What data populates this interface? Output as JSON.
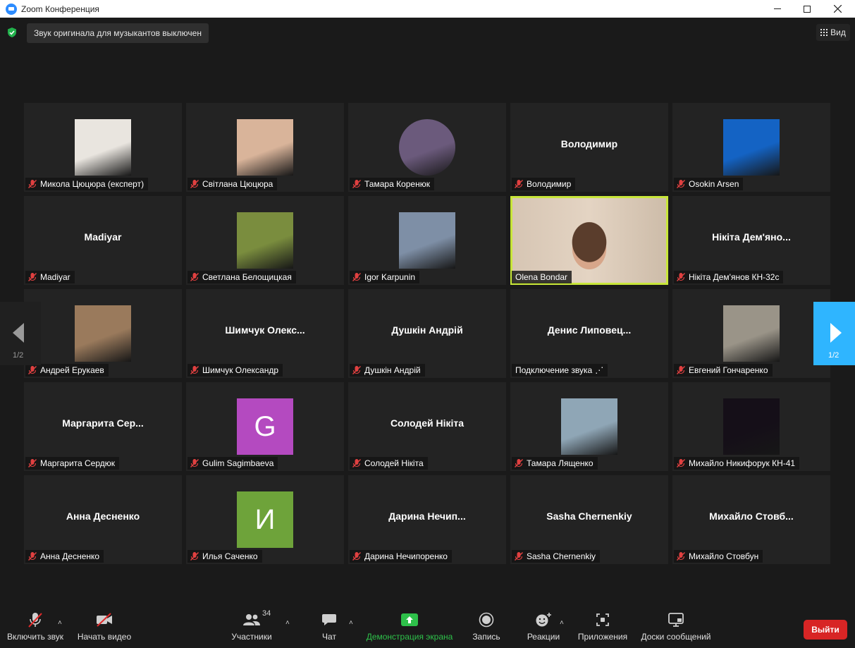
{
  "window": {
    "title": "Zoom Конференция"
  },
  "top": {
    "original_sound": "Звук оригинала для музыкантов выключен",
    "view_label": "Вид"
  },
  "nav": {
    "prev_page": "1/2",
    "next_page": "1/2"
  },
  "tiles": [
    {
      "label": "Микола Цюцюра (експерт)",
      "type": "photo",
      "color": "#e9e5df"
    },
    {
      "label": "Світлана Цюцюра",
      "type": "photo",
      "color": "#d9b49a"
    },
    {
      "label": "Тамара Коренюк",
      "type": "photo-circle",
      "color": "#6b5a7c"
    },
    {
      "label": "Володимир",
      "type": "name",
      "display": "Володимир"
    },
    {
      "label": "Osokin Arsen",
      "type": "photo",
      "color": "#1463c4"
    },
    {
      "label": "Madiyar",
      "type": "name",
      "display": "Madiyar"
    },
    {
      "label": "Светлана Белощицкая",
      "type": "photo",
      "color": "#7a8d3e"
    },
    {
      "label": "Igor Karpunin",
      "type": "photo",
      "color": "#7e8fa6"
    },
    {
      "label": "Olena Bondar",
      "type": "video",
      "active": true,
      "muted": false
    },
    {
      "label": "Нікіта Дем'янов КН-32с",
      "type": "name",
      "display": "Нікіта Дем'яно..."
    },
    {
      "label": "Андрей Ерукаев",
      "type": "photo",
      "color": "#9a7a5c"
    },
    {
      "label": "Шимчук Олександр",
      "type": "name",
      "display": "Шимчук Олекс..."
    },
    {
      "label": "Душкін Андрій",
      "type": "name",
      "display": "Душкін Андрій"
    },
    {
      "label": "Подключение звука",
      "type": "name",
      "display": "Денис Липовец...",
      "muted": false
    },
    {
      "label": "Евгений Гончаренко",
      "type": "photo",
      "color": "#9a9488"
    },
    {
      "label": "Маргарита Сердюк",
      "type": "name",
      "display": "Маргарита Сер..."
    },
    {
      "label": "Gulim Sagimbaeva",
      "type": "letter",
      "letter": "G",
      "color": "#b44ac0"
    },
    {
      "label": "Солодей Нікіта",
      "type": "name",
      "display": "Солодей Нікіта"
    },
    {
      "label": "Тамара Лященко",
      "type": "photo",
      "color": "#8fa6b6"
    },
    {
      "label": "Михайло Никифорук КН-41",
      "type": "photo",
      "color": "#150f18"
    },
    {
      "label": "Анна Десненко",
      "type": "name",
      "display": "Анна Десненко"
    },
    {
      "label": "Илья Саченко",
      "type": "letter",
      "letter": "И",
      "color": "#6ea33a"
    },
    {
      "label": "Дарина Нечипоренко",
      "type": "name",
      "display": "Дарина Нечип..."
    },
    {
      "label": "Sasha Chernenkiy",
      "type": "name",
      "display": "Sasha Chernenkiy"
    },
    {
      "label": "Михайло Стовбун",
      "type": "name",
      "display": "Михайло Стовб..."
    }
  ],
  "toolbar": {
    "unmute": "Включить звук",
    "start_video": "Начать видео",
    "participants": "Участники",
    "participants_count": "34",
    "chat": "Чат",
    "share_screen": "Демонстрация экрана",
    "record": "Запись",
    "reactions": "Реакции",
    "apps": "Приложения",
    "whiteboards": "Доски сообщений",
    "leave": "Выйти"
  },
  "colors": {
    "accent_green": "#2ec04a",
    "leave_red": "#d82525",
    "next_blue": "#2fb5ff",
    "active_outline": "#c8e63a"
  }
}
